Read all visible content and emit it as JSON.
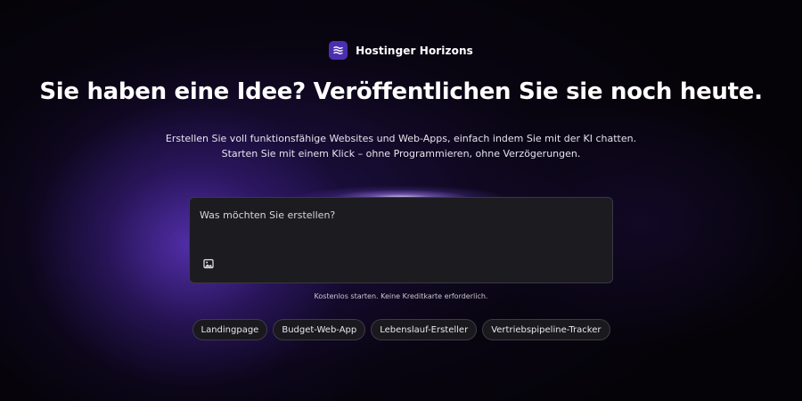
{
  "brand": {
    "name": "Hostinger Horizons",
    "logo_icon": "horizons-waves-icon",
    "logo_color": "#4b2fb0"
  },
  "hero": {
    "headline": "Sie haben eine Idee? Veröffentlichen Sie sie noch heute.",
    "subtitle_line1": "Erstellen Sie voll funktionsfähige Websites und Web-Apps, einfach indem Sie mit der KI chatten.",
    "subtitle_line2": "Starten Sie mit einem Klick – ohne Programmieren, ohne Verzögerungen."
  },
  "prompt": {
    "placeholder": "Was möchten Sie erstellen?",
    "value": "",
    "attach_icon": "image-icon"
  },
  "note": "Kostenlos starten. Keine Kreditkarte erforderlich.",
  "suggestions": [
    {
      "label": "Landingpage"
    },
    {
      "label": "Budget-Web-App"
    },
    {
      "label": "Lebenslauf-Ersteller"
    },
    {
      "label": "Vertriebspipeline-Tracker"
    }
  ],
  "colors": {
    "background": "#050308",
    "accent_glow": "#5c34be",
    "input_bg": "#1c1b20"
  }
}
